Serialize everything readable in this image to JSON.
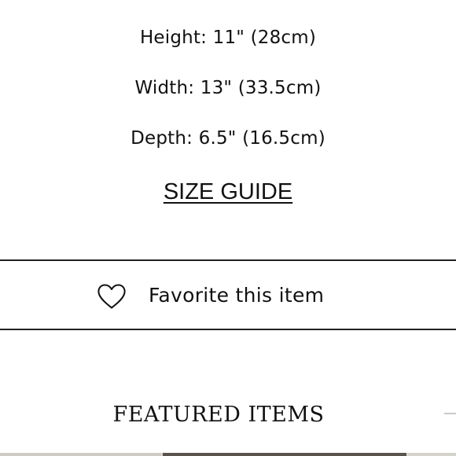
{
  "product_details": {
    "dimensions": [
      {
        "label": "Height: 11\" (28cm)"
      },
      {
        "label": "Width: 13\" (33.5cm)"
      },
      {
        "label": "Depth: 6.5\" (16.5cm)"
      }
    ],
    "size_guide_label": "SIZE GUIDE"
  },
  "favorite": {
    "label": "Favorite this item",
    "icon": "heart-outline-icon"
  },
  "featured": {
    "title": "FEATURED ITEMS"
  },
  "colors": {
    "text": "#111111",
    "divider": "#222222",
    "background": "#ffffff"
  }
}
